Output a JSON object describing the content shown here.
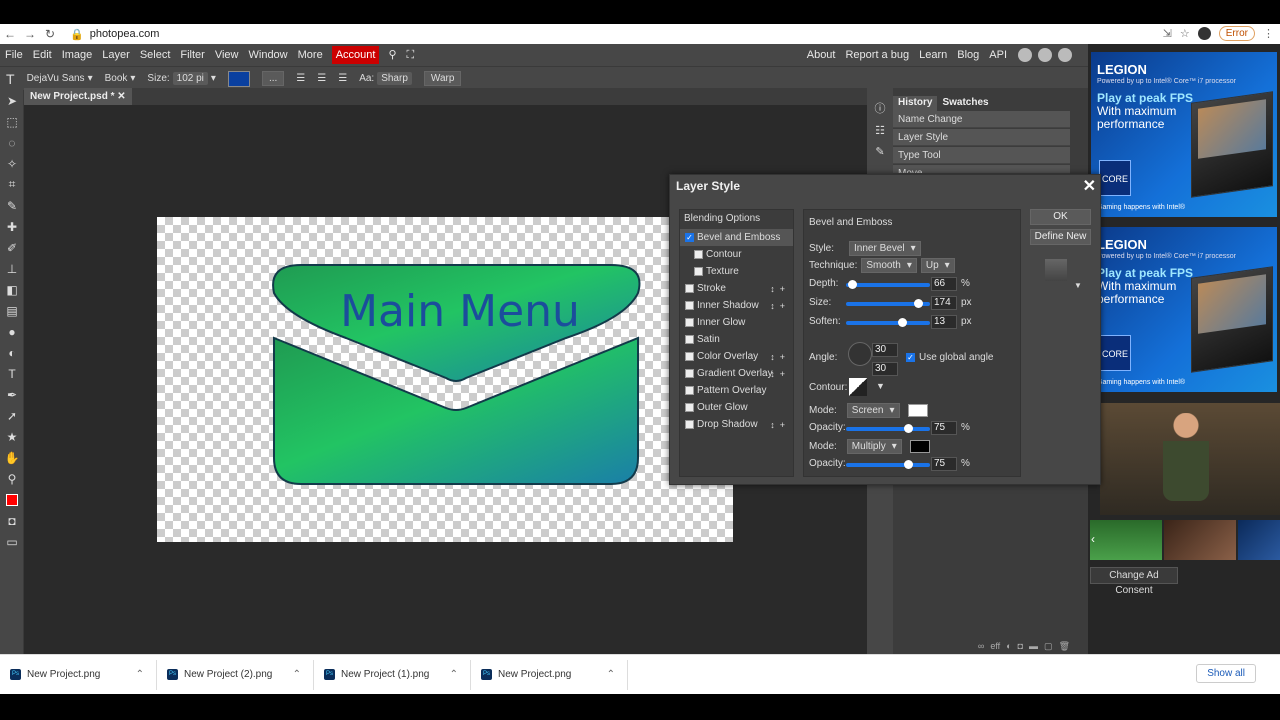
{
  "browser": {
    "url": "photopea.com",
    "error_label": "Error"
  },
  "menu": {
    "left": [
      "File",
      "Edit",
      "Image",
      "Layer",
      "Select",
      "Filter",
      "View",
      "Window",
      "More"
    ],
    "account": "Account",
    "right": [
      "About",
      "Report a bug",
      "Learn",
      "Blog",
      "API"
    ]
  },
  "options": {
    "font": "DejaVu Sans",
    "weight": "Book",
    "size_label": "Size:",
    "size": "102 pi",
    "ellipsis": "...",
    "aa_label": "Aa:",
    "aa_value": "Sharp",
    "warp": "Warp"
  },
  "document": {
    "tab": "New Project.psd *",
    "canvas_text": "Main Menu"
  },
  "panel": {
    "tabs": [
      "History",
      "Swatches"
    ],
    "history": [
      "Name Change",
      "Layer Style",
      "Type Tool",
      "Move"
    ]
  },
  "dialog": {
    "title": "Layer Style",
    "blending": "Blending Options",
    "effects": [
      {
        "label": "Bevel and Emboss",
        "checked": true,
        "sub": false,
        "pm": false
      },
      {
        "label": "Contour",
        "checked": false,
        "sub": true,
        "pm": false
      },
      {
        "label": "Texture",
        "checked": false,
        "sub": true,
        "pm": false
      },
      {
        "label": "Stroke",
        "checked": false,
        "sub": false,
        "pm": true
      },
      {
        "label": "Inner Shadow",
        "checked": false,
        "sub": false,
        "pm": true
      },
      {
        "label": "Inner Glow",
        "checked": false,
        "sub": false,
        "pm": false
      },
      {
        "label": "Satin",
        "checked": false,
        "sub": false,
        "pm": false
      },
      {
        "label": "Color Overlay",
        "checked": false,
        "sub": false,
        "pm": true
      },
      {
        "label": "Gradient Overlay",
        "checked": false,
        "sub": false,
        "pm": true
      },
      {
        "label": "Pattern Overlay",
        "checked": false,
        "sub": false,
        "pm": false
      },
      {
        "label": "Outer Glow",
        "checked": false,
        "sub": false,
        "pm": false
      },
      {
        "label": "Drop Shadow",
        "checked": false,
        "sub": false,
        "pm": true
      }
    ],
    "section": "Bevel and Emboss",
    "style_label": "Style:",
    "style": "Inner Bevel",
    "technique_label": "Technique:",
    "technique": "Smooth",
    "direction": "Up",
    "depth_label": "Depth:",
    "depth": "66",
    "depth_unit": "%",
    "size_label": "Size:",
    "size": "174",
    "size_unit": "px",
    "soften_label": "Soften:",
    "soften": "13",
    "soften_unit": "px",
    "angle_label": "Angle:",
    "angle": "30",
    "altitude": "30",
    "global_angle": "Use global angle",
    "contour_label": "Contour:",
    "mode1_label": "Mode:",
    "mode1": "Screen",
    "opacity1_label": "Opacity:",
    "opacity1": "75",
    "opacity_unit": "%",
    "mode2_label": "Mode:",
    "mode2": "Multiply",
    "opacity2_label": "Opacity:",
    "opacity2": "75",
    "ok": "OK",
    "define_new": "Define New"
  },
  "ads": {
    "brand": "LEGION",
    "sub": "Powered by up to Intel® Core™ i7 processor",
    "headline": "Play at peak FPS",
    "body": "With maximum performance",
    "intel": "CORE",
    "footer": "Gaming happens with Intel®",
    "consent": "Change Ad Consent"
  },
  "taskbar": {
    "items": [
      "New Project.png",
      "New Project (2).png",
      "New Project (1).png",
      "New Project.png"
    ],
    "show_all": "Show all"
  },
  "colors": {
    "accent": "#1a73e8",
    "account": "#cc0000",
    "panel_bg": "#474747",
    "workspace": "#2a2a2a",
    "text_blue": "#1b4d9c"
  }
}
